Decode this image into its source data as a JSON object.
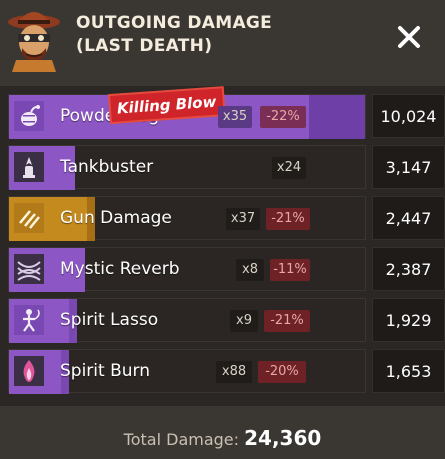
{
  "header": {
    "title_line1": "OUTGOING DAMAGE",
    "title_line2": "(LAST DEATH)"
  },
  "close_icon": "close-icon",
  "colors": {
    "purple": "#8c57c4",
    "gold": "#c58a1e",
    "red_chip": "#6e2225",
    "kill_red": "#d0242b"
  },
  "rows": [
    {
      "label": "Powder Keg",
      "count": "x35",
      "pct": "-22%",
      "value": "10,024",
      "icon": "powder-keg-icon",
      "color": "purple",
      "share": 1.0,
      "killing_blow": "Killing Blow"
    },
    {
      "label": "Tankbuster",
      "count": "x24",
      "pct": "",
      "value": "3,147",
      "icon": "tankbuster-icon",
      "color": "purple",
      "share": 0.314
    },
    {
      "label": "Gun Damage",
      "count": "x37",
      "pct": "-21%",
      "value": "2,447",
      "icon": "gun-damage-icon",
      "color": "gold",
      "share": 0.244
    },
    {
      "label": "Mystic Reverb",
      "count": "x8",
      "pct": "-11%",
      "value": "2,387",
      "icon": "mystic-reverb-icon",
      "color": "purple",
      "share": 0.238
    },
    {
      "label": "Spirit Lasso",
      "count": "x9",
      "pct": "-21%",
      "value": "1,929",
      "icon": "spirit-lasso-icon",
      "color": "purple",
      "share": 0.192
    },
    {
      "label": "Spirit Burn",
      "count": "x88",
      "pct": "-20%",
      "value": "1,653",
      "icon": "spirit-burn-icon",
      "color": "purple",
      "share": 0.165
    }
  ],
  "footer": {
    "label": "Total Damage:",
    "total": "24,360"
  }
}
